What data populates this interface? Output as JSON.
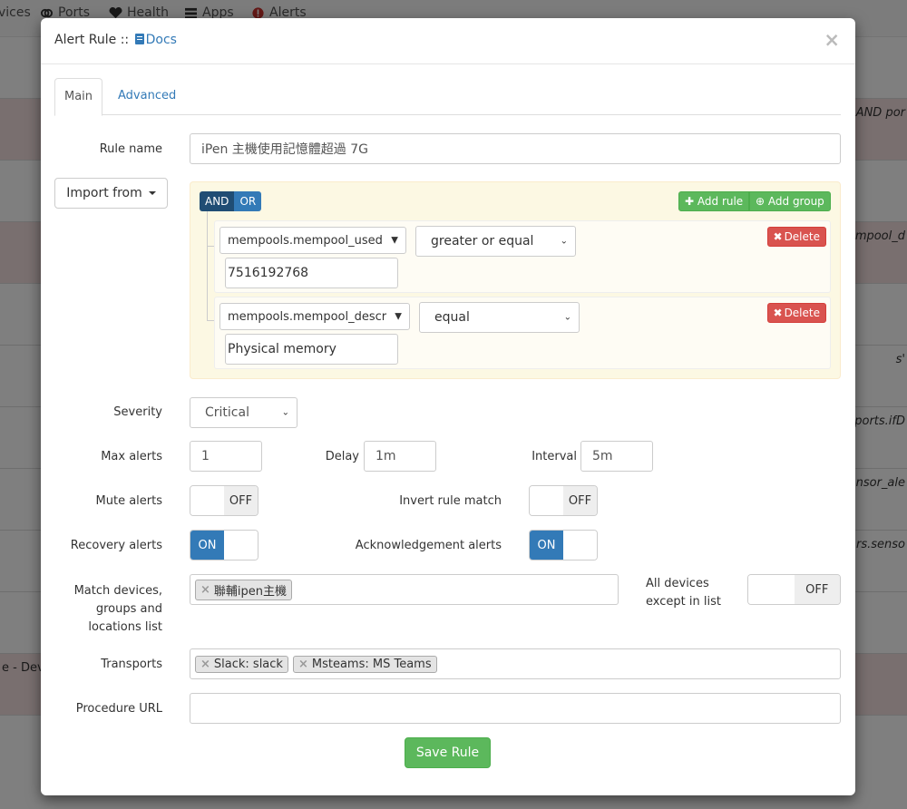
{
  "background": {
    "nav": [
      {
        "label": "vices",
        "icon": ""
      },
      {
        "label": "Ports",
        "icon": "link-icon"
      },
      {
        "label": "Health",
        "icon": "heartbeat-icon"
      },
      {
        "label": "Apps",
        "icon": "tasks-icon"
      },
      {
        "label": "Alerts",
        "icon": "exclamation-circle-icon"
      }
    ],
    "row_snippets": [
      "AND por",
      "mpool_d",
      "s'",
      "ports.ifD",
      "nsor_ale",
      "rs.senso",
      "e - Dev"
    ]
  },
  "modal": {
    "title": "Alert Rule ::",
    "docs_label": "Docs",
    "close_label": "×",
    "tabs": [
      "Main",
      "Advanced"
    ]
  },
  "form": {
    "rule_name_label": "Rule name",
    "rule_name_value": "iPen 主機使用記憶體超過 7G",
    "import_label": "Import from",
    "builder": {
      "and_label": "AND",
      "or_label": "OR",
      "add_rule_label": "Add rule",
      "add_group_label": "Add group",
      "delete_label": "Delete",
      "rules": [
        {
          "field": "mempools.mempool_used",
          "operator": "greater or equal",
          "value": "7516192768"
        },
        {
          "field": "mempools.mempool_descr",
          "operator": "equal",
          "value": "Physical memory"
        }
      ]
    },
    "severity_label": "Severity",
    "severity_value": "Critical",
    "max_alerts_label": "Max alerts",
    "max_alerts_value": "1",
    "delay_label": "Delay",
    "delay_value": "1m",
    "interval_label": "Interval",
    "interval_value": "5m",
    "mute_label": "Mute alerts",
    "mute_state": "OFF",
    "invert_label": "Invert rule match",
    "invert_state": "OFF",
    "recovery_label": "Recovery alerts",
    "recovery_state": "ON",
    "ack_label": "Acknowledgement alerts",
    "ack_state": "ON",
    "match_label_1": "Match devices,",
    "match_label_2": "groups and",
    "match_label_3": "locations list",
    "match_tags": [
      "聯輔ipen主機"
    ],
    "all_devices_label_1": "All devices",
    "all_devices_label_2": "except in list",
    "all_devices_state": "OFF",
    "transports_label": "Transports",
    "transport_tags": [
      "Slack: slack",
      "Msteams: MS Teams"
    ],
    "procedure_label": "Procedure URL",
    "procedure_value": "",
    "save_label": "Save Rule"
  },
  "colors": {
    "primary": "#337ab7",
    "success": "#5cb85c",
    "danger": "#d9534f",
    "builder_bg": "#fcf8e3"
  }
}
